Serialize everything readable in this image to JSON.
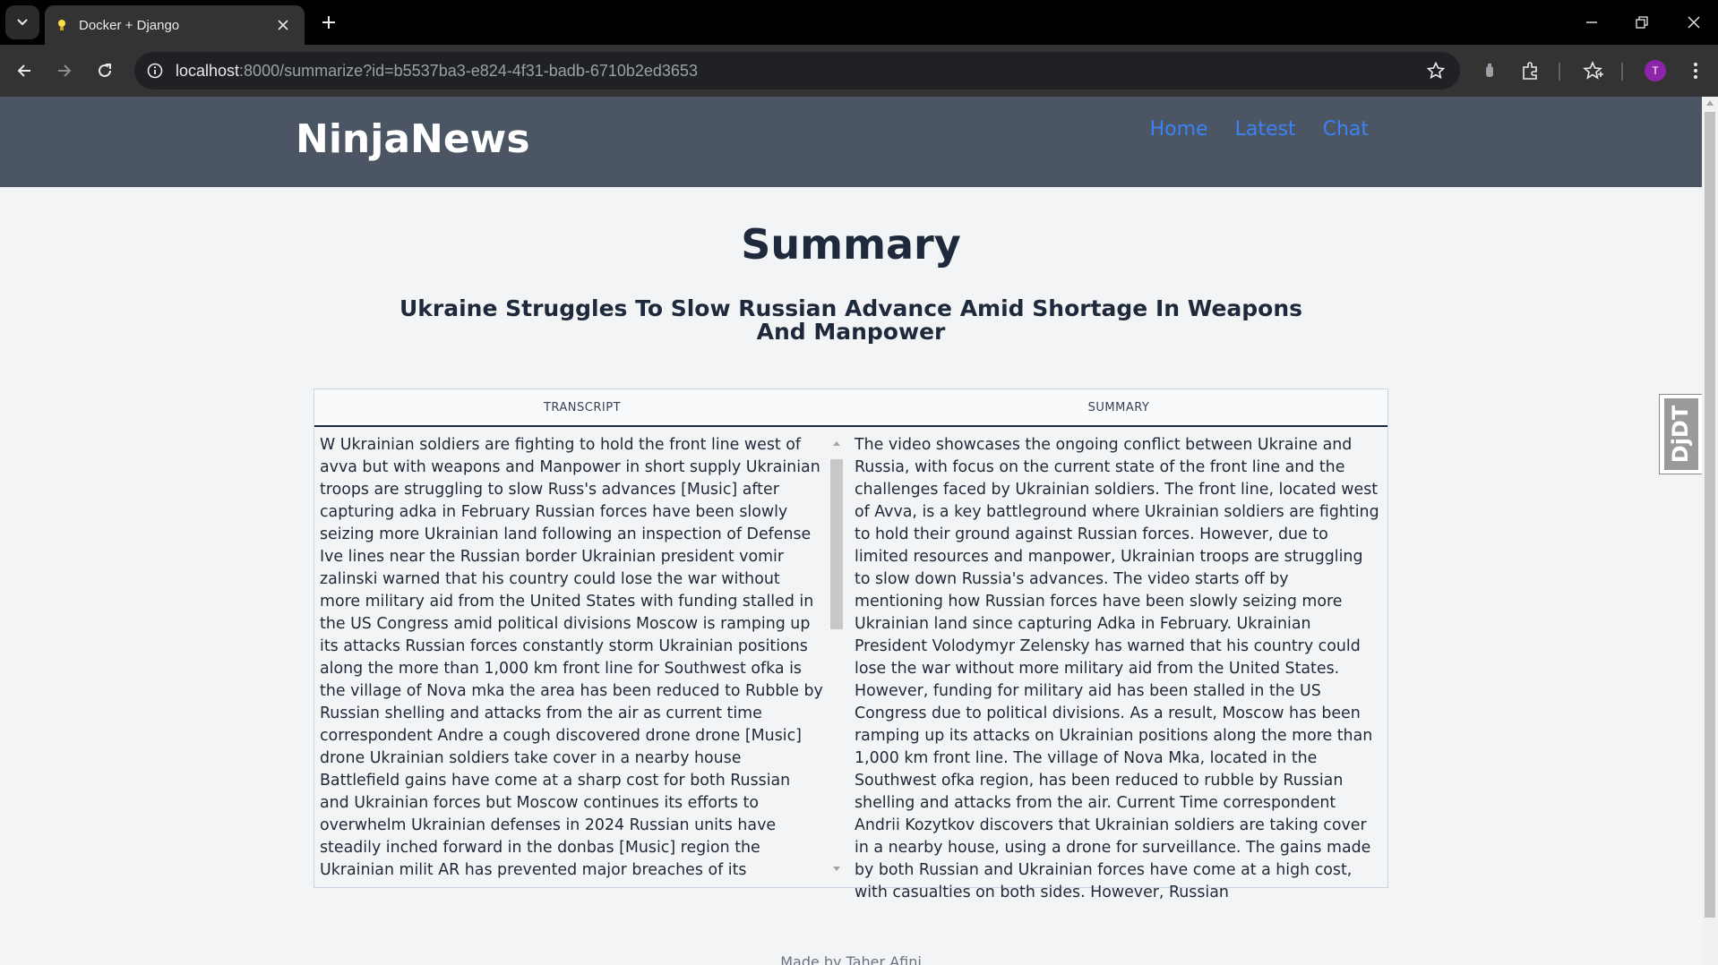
{
  "browser": {
    "tab_title": "Docker + Django",
    "url_host": "localhost",
    "url_rest": ":8000/summarize?id=b5537ba3-e824-4f31-badb-6710b2ed3653",
    "profile_initial": "T",
    "accent": "#8e24aa"
  },
  "header": {
    "brand": "NinjaNews",
    "nav": [
      "Home",
      "Latest",
      "Chat"
    ],
    "bg_color": "#4b5563",
    "link_color": "#3b82f6"
  },
  "main": {
    "page_title": "Summary",
    "article_title": "Ukraine Struggles To Slow Russian Advance Amid Shortage In Weapons And Manpower",
    "columns": [
      "TRANSCRIPT",
      "SUMMARY"
    ],
    "transcript": "W Ukrainian soldiers are fighting to hold the front line west of avva but with weapons and Manpower in short supply Ukrainian troops are struggling to slow Russ's advances [Music] after capturing adka in February Russian forces have been slowly seizing more Ukrainian land following an inspection of Defense Ive lines near the Russian border Ukrainian president vomir zalinski warned that his country could lose the war without more military aid from the United States with funding stalled in the US Congress amid political divisions Moscow is ramping up its attacks Russian forces constantly storm Ukrainian positions along the more than 1,000 km front line for Southwest ofka is the village of Nova mka the area has been reduced to Rubble by Russian shelling and attacks from the air as current time correspondent Andre a cough discovered drone drone [Music] drone Ukrainian soldiers take cover in a nearby house Battlefield gains have come at a sharp cost for both Russian and Ukrainian forces but Moscow continues its efforts to overwhelm Ukrainian defenses in 2024 Russian units have steadily inched forward in the donbas [Music] region the Ukrainian milit AR has prevented major breaches of its defensive line but renewed Russian attacks are stressing the outgunned Ukrainian troops some experts question how long a battle we Ukraine can hold off Russian advances if",
    "summary": "The video showcases the ongoing conflict between Ukraine and Russia, with focus on the current state of the front line and the challenges faced by Ukrainian soldiers. The front line, located west of Avva, is a key battleground where Ukrainian soldiers are fighting to hold their ground against Russian forces. However, due to limited resources and manpower, Ukrainian troops are struggling to slow down Russia's advances. The video starts off by mentioning how Russian forces have been slowly seizing more Ukrainian land since capturing Adka in February. Ukrainian President Volodymyr Zelensky has warned that his country could lose the war without more military aid from the United States. However, funding for military aid has been stalled in the US Congress due to political divisions. As a result, Moscow has been ramping up its attacks on Ukrainian positions along the more than 1,000 km front line. The village of Nova Mka, located in the Southwest ofka region, has been reduced to rubble by Russian shelling and attacks from the air. Current Time correspondent Andrii Kozytkov discovers that Ukrainian soldiers are taking cover in a nearby house, using a drone for surveillance. The gains made by both Russian and Ukrainian forces have come at a high cost, with casualties on both sides. However, Russian"
  },
  "footer": {
    "text": "Made by Taher Afini"
  },
  "debug_toolbar": {
    "label": "DjDT"
  }
}
